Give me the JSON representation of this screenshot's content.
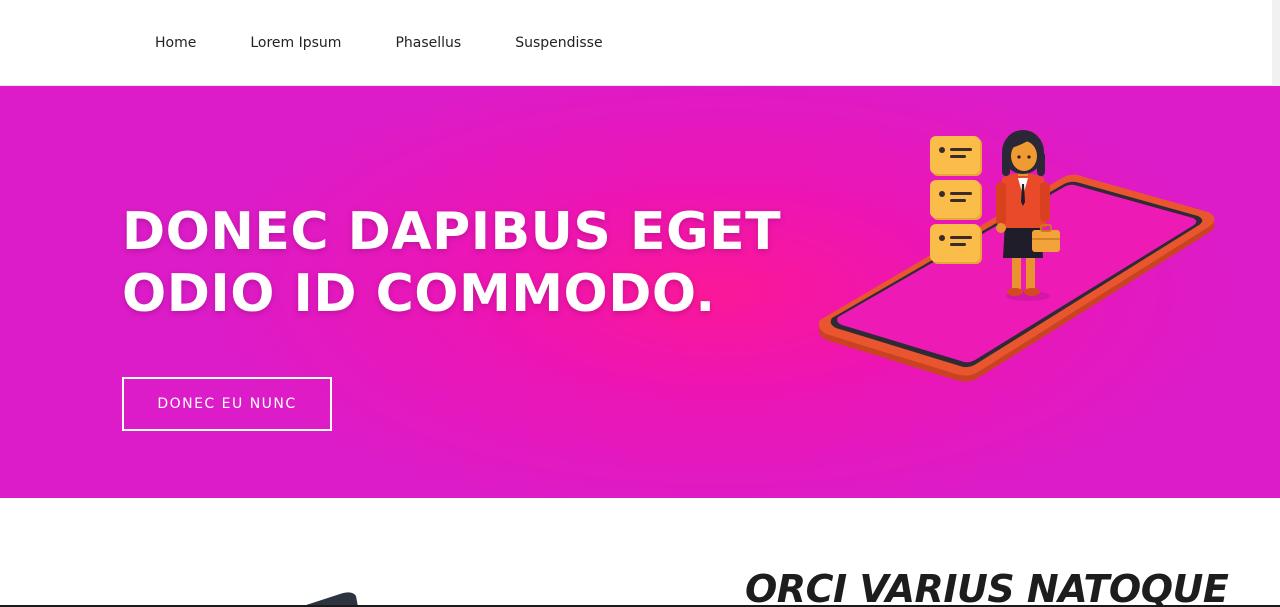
{
  "nav": {
    "items": [
      {
        "label": "Home"
      },
      {
        "label": "Lorem Ipsum"
      },
      {
        "label": "Phasellus"
      },
      {
        "label": "Suspendisse"
      }
    ]
  },
  "hero": {
    "title_line1": "DONEC DAPIBUS EGET",
    "title_line2": "ODIO ID COMMODO.",
    "button_label": "DONEC EU NUNC",
    "illustration_icon": "businesswoman-on-phone-illustration",
    "colors": {
      "gradient_center": "#fb1798",
      "gradient_edge": "#dc1cc8",
      "phone": "#e8552f",
      "cards": "#fbbd4a",
      "blazer": "#e84a2a"
    }
  },
  "section": {
    "heading": "ORCI VARIUS NATOQUE"
  }
}
